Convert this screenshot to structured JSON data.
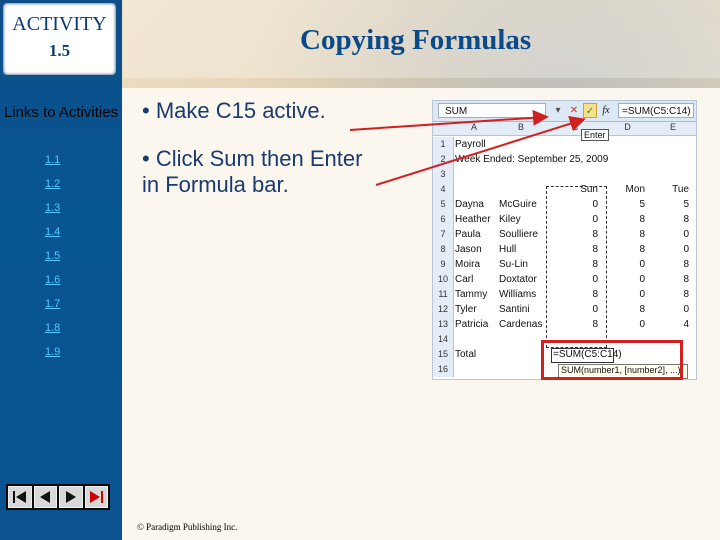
{
  "sidebar": {
    "activity_line1": "ACTIVITY",
    "activity_line2": "1.5",
    "links_title": "Links to Activities",
    "links": [
      "1.1",
      "1.2",
      "1.3",
      "1.4",
      "1.5",
      "1.6",
      "1.7",
      "1.8",
      "1.9"
    ],
    "nav_icons": [
      "first-slide-icon",
      "previous-slide-icon",
      "next-slide-icon",
      "last-slide-icon"
    ]
  },
  "header": {
    "title": "Copying Formulas"
  },
  "main": {
    "bullets": [
      "• Make C15 active.",
      "• Click Sum then Enter in Formula bar."
    ]
  },
  "excel": {
    "name_box": "SUM",
    "formula": "=SUM(C5:C14)",
    "enter_tooltip": "Enter",
    "columns": [
      "A",
      "B",
      "C",
      "D",
      "E"
    ],
    "rows": [
      {
        "n": "1",
        "a": "Payroll",
        "b": "",
        "c": "",
        "d": "",
        "e": ""
      },
      {
        "n": "2",
        "a": "Week Ended: September 25, 2009",
        "b": "",
        "c": "",
        "d": "",
        "e": ""
      },
      {
        "n": "3",
        "a": "",
        "b": "",
        "c": "",
        "d": "",
        "e": ""
      },
      {
        "n": "4",
        "a": "",
        "b": "",
        "c": "Sun",
        "d": "Mon",
        "e": "Tue"
      },
      {
        "n": "5",
        "a": "Dayna",
        "b": "McGuire",
        "c": "0",
        "d": "5",
        "e": "5"
      },
      {
        "n": "6",
        "a": "Heather",
        "b": "Kiley",
        "c": "0",
        "d": "8",
        "e": "8"
      },
      {
        "n": "7",
        "a": "Paula",
        "b": "Soulliere",
        "c": "8",
        "d": "8",
        "e": "0"
      },
      {
        "n": "8",
        "a": "Jason",
        "b": "Hull",
        "c": "8",
        "d": "8",
        "e": "0"
      },
      {
        "n": "9",
        "a": "Moira",
        "b": "Su-Lin",
        "c": "8",
        "d": "0",
        "e": "8"
      },
      {
        "n": "10",
        "a": "Carl",
        "b": "Doxtator",
        "c": "0",
        "d": "0",
        "e": "8"
      },
      {
        "n": "11",
        "a": "Tammy",
        "b": "Williams",
        "c": "8",
        "d": "0",
        "e": "8"
      },
      {
        "n": "12",
        "a": "Tyler",
        "b": "Santini",
        "c": "0",
        "d": "8",
        "e": "0"
      },
      {
        "n": "13",
        "a": "Patricia",
        "b": "Cardenas",
        "c": "8",
        "d": "0",
        "e": "4"
      },
      {
        "n": "14",
        "a": "",
        "b": "",
        "c": "",
        "d": "",
        "e": ""
      },
      {
        "n": "15",
        "a": "Total",
        "b": "",
        "c": "",
        "d": "",
        "e": ""
      },
      {
        "n": "16",
        "a": "",
        "b": "",
        "c": "",
        "d": "",
        "e": ""
      }
    ],
    "active_cell_formula": "=SUM(C5:C14)",
    "function_hint": "SUM(number1, [number2], ...)"
  },
  "footer": "© Paradigm Publishing Inc.",
  "colors": {
    "sidebar": "#0a5390",
    "title": "#0b4a8a",
    "arrow": "#d02020"
  }
}
